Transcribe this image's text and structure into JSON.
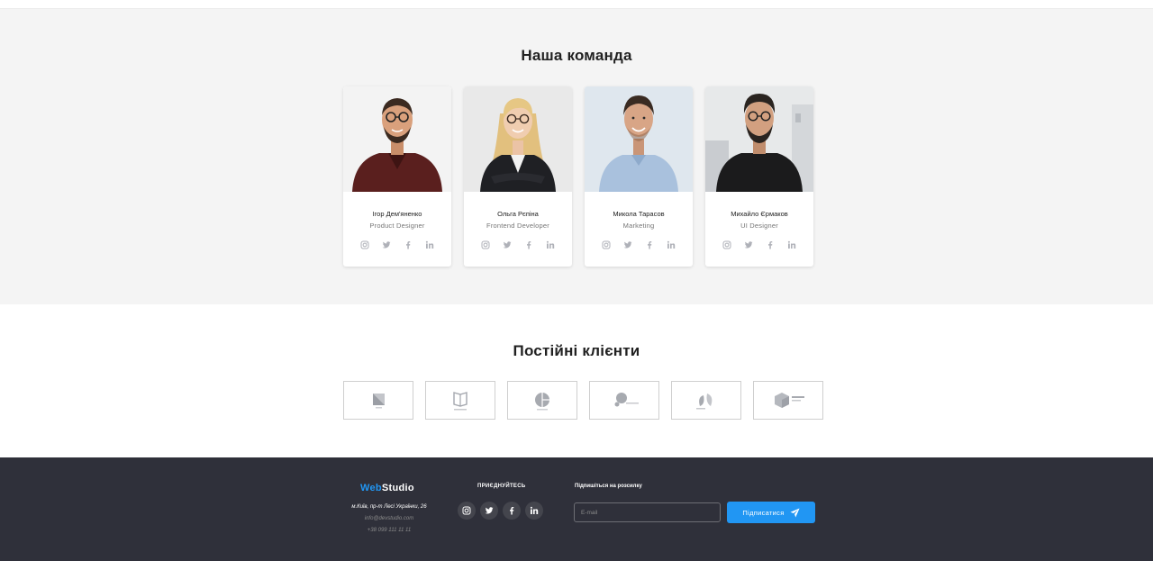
{
  "team": {
    "title": "Наша команда",
    "members": [
      {
        "name": "Ігор Дем'яненко",
        "role": "Product Designer",
        "socials": [
          "instagram-icon",
          "twitter-icon",
          "facebook-icon",
          "linkedin-icon"
        ]
      },
      {
        "name": "Ольга Рєпіна",
        "role": "Frontend Developer",
        "socials": [
          "instagram-icon",
          "twitter-icon",
          "facebook-icon",
          "linkedin-icon"
        ]
      },
      {
        "name": "Микола Тарасов",
        "role": "Marketing",
        "socials": [
          "instagram-icon",
          "twitter-icon",
          "facebook-icon",
          "linkedin-icon"
        ]
      },
      {
        "name": "Михайло Єрмаков",
        "role": "UI Designer",
        "socials": [
          "instagram-icon",
          "twitter-icon",
          "facebook-icon",
          "linkedin-icon"
        ]
      }
    ]
  },
  "clients": {
    "title": "Постійні клієнти",
    "logos": [
      "client-logo-1",
      "client-logo-2",
      "client-logo-3",
      "client-logo-4",
      "client-logo-5",
      "client-logo-6"
    ]
  },
  "footer": {
    "logo_web": "Web",
    "logo_studio": "Studio",
    "address": "м.Київ, пр-т Лесі Українки, 26",
    "email": "info@devstudio.com",
    "phone": "+38 099 111 11 11",
    "join_label": "ПРИЄДНУЙТЕСЬ",
    "subscribe_label": "Підпишіться на розсилку",
    "email_placeholder": "E-mail",
    "subscribe_button": "Підписатися"
  },
  "colors": {
    "accent": "#2196f3",
    "footer_bg": "#2f303a",
    "section_bg": "#f4f4f4",
    "icon_grey": "#afb1b8"
  }
}
